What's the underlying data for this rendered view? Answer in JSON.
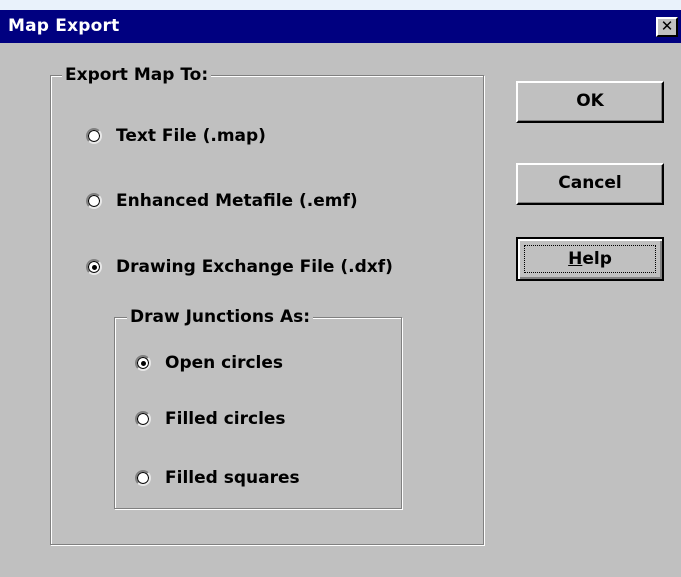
{
  "dialog": {
    "title": "Map Export",
    "close_label": "✕"
  },
  "export_group": {
    "label": "Export Map To:",
    "options": [
      {
        "label": "Text File (.map)",
        "checked": false
      },
      {
        "label": "Enhanced Metafile (.emf)",
        "checked": false
      },
      {
        "label": "Drawing Exchange File (.dxf)",
        "checked": true
      }
    ]
  },
  "junction_group": {
    "label": "Draw Junctions As:",
    "options": [
      {
        "label": "Open circles",
        "checked": true
      },
      {
        "label": "Filled circles",
        "checked": false
      },
      {
        "label": "Filled squares",
        "checked": false
      }
    ]
  },
  "buttons": {
    "ok": "OK",
    "cancel": "Cancel",
    "help_mnemonic": "H",
    "help_rest": "elp"
  }
}
